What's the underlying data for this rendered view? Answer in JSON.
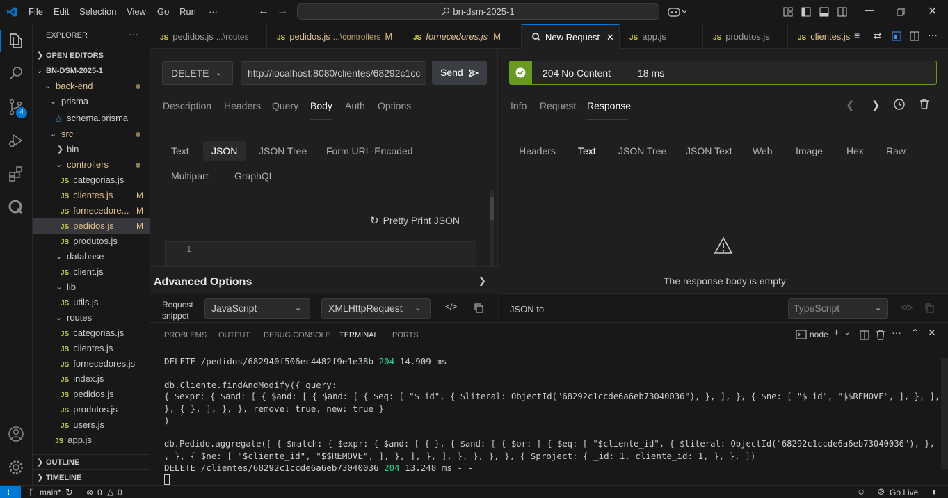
{
  "menu": [
    "File",
    "Edit",
    "Selection",
    "View",
    "Go",
    "Run",
    "···"
  ],
  "search": {
    "text": "bn-dsm-2025-1"
  },
  "sidebar": {
    "title": "EXPLORER",
    "open_editors": "OPEN EDITORS",
    "root": "BN-DSM-2025-1",
    "outline": "OUTLINE",
    "timeline": "TIMELINE",
    "tree": [
      {
        "label": "back-end",
        "kind": "folder-open"
      },
      {
        "label": "prisma",
        "kind": "folder-open"
      },
      {
        "label": "schema.prisma",
        "kind": "file"
      },
      {
        "label": "src",
        "kind": "folder-open"
      },
      {
        "label": "bin",
        "kind": "folder-closed"
      },
      {
        "label": "controllers",
        "kind": "folder-open"
      },
      {
        "label": "categorias.js",
        "kind": "js"
      },
      {
        "label": "clientes.js",
        "kind": "js",
        "flag": "M"
      },
      {
        "label": "fornecedore...",
        "kind": "js",
        "flag": "M"
      },
      {
        "label": "pedidos.js",
        "kind": "js",
        "flag": "M"
      },
      {
        "label": "produtos.js",
        "kind": "js"
      },
      {
        "label": "database",
        "kind": "folder-open"
      },
      {
        "label": "client.js",
        "kind": "js"
      },
      {
        "label": "lib",
        "kind": "folder-open"
      },
      {
        "label": "utils.js",
        "kind": "js"
      },
      {
        "label": "routes",
        "kind": "folder-open"
      },
      {
        "label": "categorias.js",
        "kind": "js"
      },
      {
        "label": "clientes.js",
        "kind": "js"
      },
      {
        "label": "fornecedores.js",
        "kind": "js"
      },
      {
        "label": "index.js",
        "kind": "js"
      },
      {
        "label": "pedidos.js",
        "kind": "js"
      },
      {
        "label": "produtos.js",
        "kind": "js"
      },
      {
        "label": "users.js",
        "kind": "js"
      },
      {
        "label": "app.js",
        "kind": "js"
      }
    ]
  },
  "tabs": [
    {
      "label": "pedidos.js",
      "sub": "...\\routes"
    },
    {
      "label": "pedidos.js",
      "sub": "...\\controllers",
      "flag": "M"
    },
    {
      "label": "fornecedores.js",
      "flag": "M"
    },
    {
      "label": "New Request"
    },
    {
      "label": "app.js"
    },
    {
      "label": "produtos.js"
    },
    {
      "label": "clientes.js"
    }
  ],
  "badges": {
    "scm": "4"
  },
  "request": {
    "method": "DELETE",
    "url": "http://localhost:8080/clientes/68292c1cc",
    "send": "Send",
    "tabs": [
      "Description",
      "Headers",
      "Query",
      "Body",
      "Auth",
      "Options"
    ],
    "body_tabs": [
      "Text",
      "JSON",
      "JSON Tree",
      "Form URL-Encoded",
      "Multipart",
      "GraphQL"
    ],
    "pretty_print": "Pretty Print JSON",
    "line_no": "1",
    "advanced": "Advanced Options",
    "snippet_label_1": "Request",
    "snippet_label_2": "snippet",
    "lang": "JavaScript",
    "lib": "XMLHttpRequest"
  },
  "response": {
    "status": "204 No Content",
    "sep": "·",
    "time": "18 ms",
    "tabs": [
      "Info",
      "Request",
      "Response"
    ],
    "view_tabs": [
      "Headers",
      "Text",
      "JSON Tree",
      "JSON Text",
      "Web",
      "Image",
      "Hex",
      "Raw"
    ],
    "empty": "The response body is empty",
    "json_to": "JSON to",
    "json_to_value": "TypeScript"
  },
  "panel": {
    "tabs": [
      "PROBLEMS",
      "OUTPUT",
      "DEBUG CONSOLE",
      "TERMINAL",
      "PORTS"
    ],
    "shell": "node",
    "lines": [
      {
        "pre": "DELETE /pedidos/682940f506ec4482f9e1e38b ",
        "status": "204",
        "post": " 14.909 ms - -"
      },
      {
        "pre": "------------------------------------------"
      },
      {
        "pre": "db.Cliente.findAndModify({ query:"
      },
      {
        "pre": "{ $expr: { $and: [ { $and: [ { $and: [ { $eq: [ \"$_id\", { $literal: ObjectId(\"68292c1ccde6a6eb73040036\"), }, ], }, { $ne: [ \"$_id\", \"$$REMOVE\", ], }, ], }, ],"
      },
      {
        "pre": "}, { }, ], }, }, remove: true, new: true }"
      },
      {
        "pre": ")"
      },
      {
        "pre": "------------------------------------------"
      },
      {
        "pre": "db.Pedido.aggregate([ { $match: { $expr: { $and: [ { }, { $and: [ { $or: [ { $eq: [ \"$cliente_id\", { $literal: ObjectId(\"68292c1ccde6a6eb73040036\"), }, ], }, ]"
      },
      {
        "pre": ", }, { $ne: [ \"$cliente_id\", \"$$REMOVE\", ], }, ], }, ], }, }, }, }, { $project: { _id: 1, cliente_id: 1, }, }, ])"
      },
      {
        "pre": "DELETE /clientes/68292c1ccde6a6eb73040036 ",
        "status": "204",
        "post": " 13.248 ms - -"
      }
    ]
  },
  "status": {
    "branch": "main*",
    "errors": "0",
    "warnings": "0",
    "golive": "Go Live"
  },
  "colors": {
    "accent": "#0078d4",
    "success": "#6a9a23",
    "modified": "#e2c08d"
  }
}
